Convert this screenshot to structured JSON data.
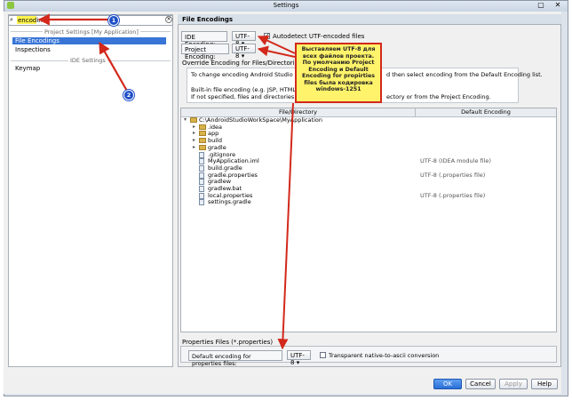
{
  "window": {
    "title": "Settings"
  },
  "search": {
    "value": "encodin"
  },
  "left": {
    "section_project": "Project Settings [My Application]",
    "items_project": [
      "File Encodings",
      "Inspections"
    ],
    "section_ide": "IDE Settings",
    "items_ide": [
      "Keymap"
    ]
  },
  "right": {
    "title": "File Encodings",
    "ide_encoding_label": "IDE Encoding:",
    "ide_encoding_value": "UTF-8",
    "autodetect_label": "Autodetect UTF-encoded files",
    "autodetect_checked": true,
    "project_encoding_label": "Project Encoding:",
    "project_encoding_value": "UTF-8",
    "override_label": "Override Encoding for Files/Directories",
    "info_line1": "To change encoding Android Studio uses f",
    "info_line1b": "d then select encoding from the Default Encoding list.",
    "info_line2": "Built-in file encoding (e.g. JSP, HTML or XM",
    "info_line3": "If not specified, files and directories inherit e",
    "info_line3b": "ectory or from the Project Encoding.",
    "col_file": "File/Directory",
    "col_encoding": "Default Encoding",
    "tree": [
      {
        "name": "C:\\AndroidStudioWorkSpace\\MyApplication",
        "type": "folder",
        "level": 0,
        "enc": ""
      },
      {
        "name": ".idea",
        "type": "folder",
        "level": 1,
        "enc": ""
      },
      {
        "name": "app",
        "type": "folder",
        "level": 1,
        "enc": ""
      },
      {
        "name": "build",
        "type": "folder",
        "level": 1,
        "enc": ""
      },
      {
        "name": "gradle",
        "type": "folder",
        "level": 1,
        "enc": ""
      },
      {
        "name": ".gitignore",
        "type": "file",
        "level": 1,
        "enc": ""
      },
      {
        "name": "MyApplication.iml",
        "type": "file",
        "level": 1,
        "enc": "UTF-8 (IDEA module file)"
      },
      {
        "name": "build.gradle",
        "type": "file",
        "level": 1,
        "enc": ""
      },
      {
        "name": "gradle.properties",
        "type": "file",
        "level": 1,
        "enc": "UTF-8 (.properties file)"
      },
      {
        "name": "gradlew",
        "type": "file",
        "level": 1,
        "enc": ""
      },
      {
        "name": "gradlew.bat",
        "type": "file",
        "level": 1,
        "enc": ""
      },
      {
        "name": "local.properties",
        "type": "file",
        "level": 1,
        "enc": "UTF-8 (.properties file)"
      },
      {
        "name": "settings.gradle",
        "type": "file",
        "level": 1,
        "enc": ""
      }
    ],
    "properties_group": "Properties Files (*.properties)",
    "default_props_label": "Default encoding for properties files:",
    "default_props_value": "UTF-8",
    "native_ascii_label": "Transparent native-to-ascii conversion",
    "native_ascii_checked": false
  },
  "annotation": {
    "note": "Выставляем UTF-8 для всех файлов проекта. По умолчанию Project Encoding и Default Encoding for propirties files была кодировка windows-1251",
    "badge1": "1",
    "badge2": "2"
  },
  "buttons": {
    "ok": "OK",
    "cancel": "Cancel",
    "apply": "Apply",
    "help": "Help"
  },
  "colors": {
    "selection": "#3875d7",
    "note_bg": "#fff36b",
    "arrow": "#d2291b",
    "badge": "#1e4fc6"
  }
}
